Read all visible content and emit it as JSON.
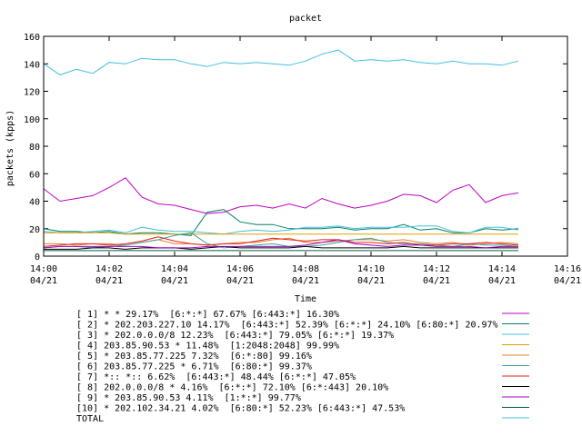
{
  "chart_data": {
    "type": "line",
    "title": "packet",
    "xlabel": "Time",
    "ylabel": "packets (kpps)",
    "ylim": [
      0,
      160
    ],
    "yticks": [
      0,
      20,
      40,
      60,
      80,
      100,
      120,
      140,
      160
    ],
    "xlim": [
      0,
      16
    ],
    "xticks": [
      {
        "v": 0,
        "time": "14:00",
        "date": "04/21"
      },
      {
        "v": 2,
        "time": "14:02",
        "date": "04/21"
      },
      {
        "v": 4,
        "time": "14:04",
        "date": "04/21"
      },
      {
        "v": 6,
        "time": "14:06",
        "date": "04/21"
      },
      {
        "v": 8,
        "time": "14:08",
        "date": "04/21"
      },
      {
        "v": 10,
        "time": "14:10",
        "date": "04/21"
      },
      {
        "v": 12,
        "time": "14:12",
        "date": "04/21"
      },
      {
        "v": 14,
        "time": "14:14",
        "date": "04/21"
      },
      {
        "v": 16,
        "time": "14:16",
        "date": "04/21"
      }
    ],
    "x": [
      0,
      0.5,
      1,
      1.5,
      2,
      2.5,
      3,
      3.5,
      4,
      4.5,
      5,
      5.5,
      6,
      6.5,
      7,
      7.5,
      8,
      8.5,
      9,
      9.5,
      10,
      10.5,
      11,
      11.5,
      12,
      12.5,
      13,
      13.5,
      14,
      14.5
    ],
    "series": [
      {
        "name": "[ 1] * * 29.17%  [6:*:*] 67.67% [6:443:*] 16.30%",
        "color": "#c000c0",
        "values": [
          49,
          40,
          42,
          44,
          50,
          57,
          43,
          38,
          37,
          34,
          31,
          32,
          36,
          37,
          35,
          38,
          35,
          42,
          38,
          35,
          37,
          40,
          45,
          44,
          39,
          48,
          52,
          39,
          44,
          46
        ]
      },
      {
        "name": "[ 2] * 202.203.227.10 14.17%  [6:443:*] 52.39% [6:*:*] 24.10% [6:80:*] 20.97%",
        "color": "#008060",
        "values": [
          20,
          18,
          18,
          17,
          18,
          16,
          17,
          17,
          16,
          15,
          32,
          34,
          25,
          23,
          23,
          20,
          20,
          20,
          21,
          19,
          20,
          20,
          23,
          19,
          20,
          17,
          17,
          20,
          19,
          20
        ]
      },
      {
        "name": "[ 3] * 202.0.0.0/8 12.23%  [6:443:*] 79.05% [6:*:*] 19.37%",
        "color": "#40c0e0",
        "values": [
          18,
          17,
          17,
          18,
          19,
          17,
          21,
          19,
          18,
          18,
          17,
          16,
          18,
          19,
          18,
          19,
          21,
          21,
          22,
          20,
          21,
          21,
          21,
          22,
          22,
          18,
          17,
          21,
          21,
          19
        ]
      },
      {
        "name": "[ 4] 203.85.90.53 * 11.48%  [1:2048:2048] 99.99%",
        "color": "#e0a000",
        "values": [
          17,
          17,
          17,
          17,
          17,
          16,
          16,
          16,
          16,
          16,
          16,
          16,
          16,
          16,
          16,
          16,
          16,
          16,
          16,
          16,
          16,
          16,
          16,
          16,
          16,
          16,
          16,
          16,
          16,
          16
        ]
      },
      {
        "name": "[ 5] * 203.85.77.225 7.32%  [6:*:80] 99.16%",
        "color": "#e08020",
        "values": [
          9,
          9,
          8,
          9,
          9,
          8,
          10,
          12,
          9,
          9,
          8,
          9,
          10,
          10,
          12,
          13,
          10,
          10,
          11,
          12,
          12,
          11,
          12,
          10,
          9,
          10,
          8,
          9,
          10,
          9
        ]
      },
      {
        "name": "[ 6] 203.85.77.225 * 6.71%  [6:80:*] 99.37%",
        "color": "#40a0a0",
        "values": [
          6,
          7,
          7,
          6,
          7,
          8,
          10,
          12,
          15,
          17,
          9,
          6,
          7,
          8,
          9,
          7,
          7,
          8,
          10,
          12,
          13,
          10,
          9,
          9,
          8,
          7,
          9,
          8,
          8,
          7
        ]
      },
      {
        "name": "[ 7] *:: *:: 6.62%  [6:443:*] 48.44% [6:*:*] 47.05%",
        "color": "#e02020",
        "values": [
          7,
          8,
          9,
          9,
          8,
          9,
          11,
          14,
          11,
          9,
          8,
          9,
          9,
          11,
          13,
          12,
          11,
          12,
          12,
          10,
          10,
          9,
          10,
          8,
          8,
          9,
          9,
          10,
          9,
          8
        ]
      },
      {
        "name": "[ 8] 202.0.0.0/8 * 4.16%  [6:*:*] 72.10% [6:*:443] 20.10%",
        "color": "#000000",
        "values": [
          5,
          5,
          5,
          6,
          6,
          5,
          6,
          6,
          6,
          5,
          6,
          7,
          6,
          6,
          6,
          6,
          7,
          6,
          6,
          6,
          6,
          6,
          7,
          6,
          6,
          6,
          6,
          6,
          6,
          6
        ]
      },
      {
        "name": "[ 9] * 203.85.90.53 4.11%  [1:*:*] 99.77%",
        "color": "#a000c0",
        "values": [
          6,
          7,
          7,
          7,
          7,
          7,
          7,
          6,
          6,
          6,
          7,
          7,
          7,
          7,
          7,
          7,
          8,
          10,
          12,
          9,
          8,
          7,
          8,
          8,
          7,
          7,
          7,
          6,
          7,
          7
        ]
      },
      {
        "name": "[10] * 202.102.34.21 4.02%  [6:80:*] 52.23% [6:443:*] 47.53%",
        "color": "#006040",
        "values": [
          4,
          4,
          4,
          4,
          4,
          4,
          4,
          4,
          4,
          4,
          4,
          4,
          4,
          4,
          4,
          4,
          4,
          4,
          4,
          4,
          4,
          4,
          4,
          4,
          4,
          4,
          4,
          4,
          4,
          4
        ]
      },
      {
        "name": "TOTAL",
        "color": "#40c0e0",
        "values": [
          140,
          132,
          136,
          133,
          141,
          140,
          144,
          143,
          143,
          140,
          138,
          141,
          140,
          141,
          140,
          139,
          142,
          147,
          150,
          142,
          143,
          142,
          143,
          141,
          140,
          142,
          140,
          140,
          139,
          142
        ]
      }
    ]
  }
}
